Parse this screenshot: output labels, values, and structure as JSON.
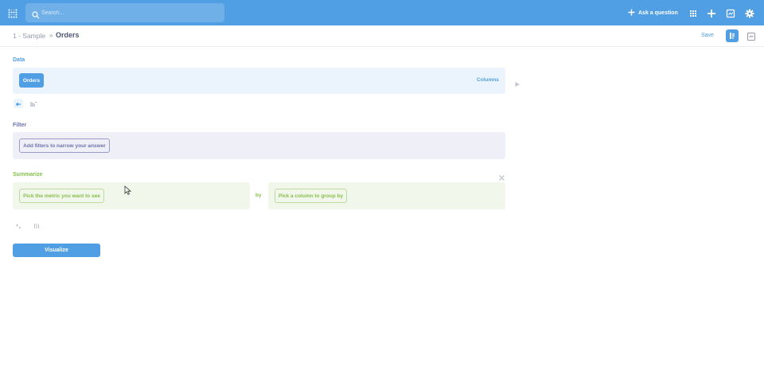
{
  "navbar": {
    "search_placeholder": "Search…",
    "ask_question_label": "Ask a question",
    "icons": [
      "metabase-logo-icon",
      "search-icon",
      "plus-icon",
      "grid-icon",
      "plus-icon",
      "dashboard-icon",
      "gear-icon"
    ],
    "bg_color": "#509ee3"
  },
  "header": {
    "database": "1 - Sample",
    "separator": "»",
    "table": "Orders",
    "save_label": "Save"
  },
  "data_step": {
    "label": "Data",
    "table_pill": "Orders",
    "columns_label": "Columns",
    "color": "#509ee3"
  },
  "filter_step": {
    "label": "Filter",
    "placeholder": "Add filters to narrow your answer",
    "color": "#7172ad"
  },
  "summarize_step": {
    "label": "Summarize",
    "metric_placeholder": "Pick the metric you want to see",
    "by_label": "by",
    "group_placeholder": "Pick a column to group by",
    "color": "#88bf4d"
  },
  "actions": {
    "visualize_label": "Visualize"
  }
}
